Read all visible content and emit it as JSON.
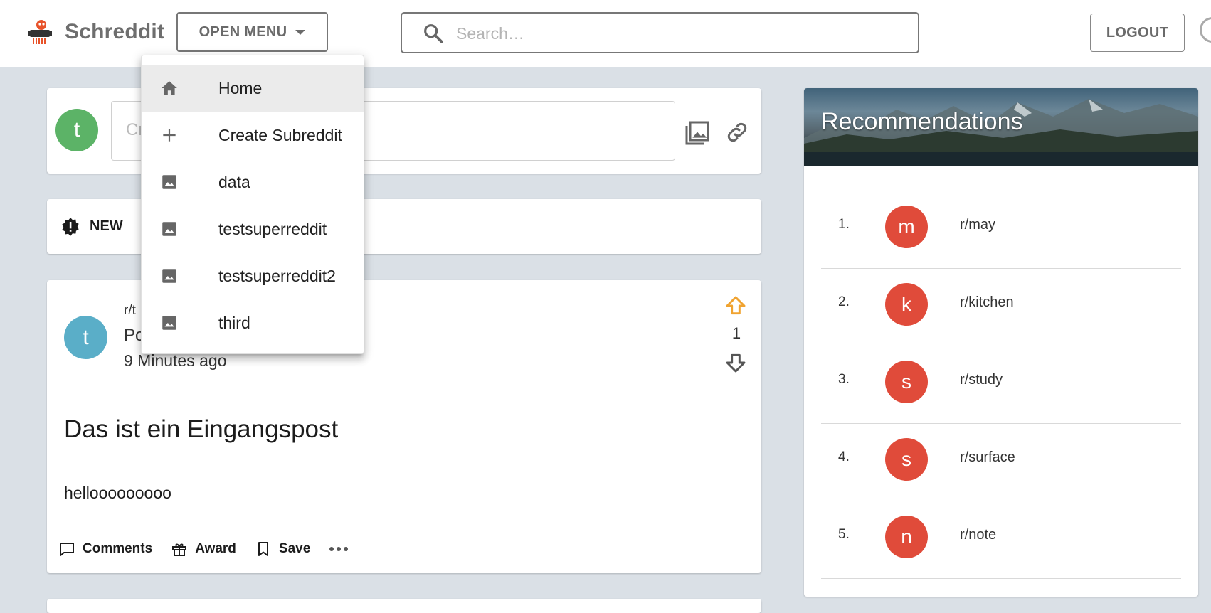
{
  "header": {
    "brand": "Schreddit",
    "open_menu_label": "OPEN MENU",
    "search_placeholder": "Search…",
    "logout_label": "LOGOUT"
  },
  "menu": {
    "items": [
      {
        "label": "Home",
        "icon": "home-icon"
      },
      {
        "label": "Create Subreddit",
        "icon": "plus-icon"
      },
      {
        "label": "data",
        "icon": "image-icon"
      },
      {
        "label": "testsuperreddit",
        "icon": "image-icon"
      },
      {
        "label": "testsuperreddit2",
        "icon": "image-icon"
      },
      {
        "label": "third",
        "icon": "image-icon"
      }
    ]
  },
  "create_post": {
    "avatar_letter": "t",
    "placeholder_visible": "Cr"
  },
  "sort": {
    "label": "NEW"
  },
  "post": {
    "avatar_letter": "t",
    "subreddit_visible": "r/t",
    "author_visible": "Po",
    "time": "9 Minutes ago",
    "votes": "1",
    "title": "Das ist ein Eingangspost",
    "body": "hellooooooooo",
    "actions": {
      "comments": "Comments",
      "award": "Award",
      "save": "Save"
    }
  },
  "recommendations": {
    "title": "Recommendations",
    "items": [
      {
        "rank": "1.",
        "letter": "m",
        "name": "r/may"
      },
      {
        "rank": "2.",
        "letter": "k",
        "name": "r/kitchen"
      },
      {
        "rank": "3.",
        "letter": "s",
        "name": "r/study"
      },
      {
        "rank": "4.",
        "letter": "s",
        "name": "r/surface"
      },
      {
        "rank": "5.",
        "letter": "n",
        "name": "r/note"
      }
    ]
  },
  "colors": {
    "page_bg": "#dae0e6",
    "create_avatar": "#5cb367",
    "post_avatar": "#5aaec8",
    "rec_avatar": "#e04b3a",
    "upvote_active": "#f0a330",
    "menu_active_bg": "#ebebeb"
  }
}
